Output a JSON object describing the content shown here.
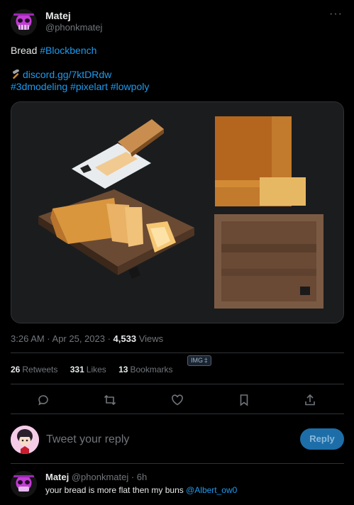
{
  "author": {
    "name": "Matej",
    "handle": "@phonkmatej",
    "avatar_icon": "purple-skull-avatar"
  },
  "tweet": {
    "line1_text": "Bread ",
    "line1_hashtag": "#Blockbench",
    "link_icon": "hammer-icon",
    "link_text": "discord.gg/7ktDRdw",
    "hashtags": "#3dmodeling #pixelart #lowpoly",
    "media_alt": "IMG"
  },
  "meta": {
    "time": "3:26 AM · Apr 25, 2023 · ",
    "views_count": "4,533",
    "views_label": " Views"
  },
  "stats": {
    "retweets_count": "26",
    "retweets_label": "Retweets",
    "likes_count": "331",
    "likes_label": "Likes",
    "bookmarks_count": "13",
    "bookmarks_label": "Bookmarks",
    "badge": "IMG ‡"
  },
  "actions": [
    "reply-icon",
    "retweet-icon",
    "like-icon",
    "bookmark-icon",
    "share-icon"
  ],
  "reply": {
    "placeholder": "Tweet your reply",
    "button_label": "Reply"
  },
  "comment": {
    "name": "Matej",
    "handle_time": " @phonkmatej · 6h",
    "text": "your bread is more flat then my buns ",
    "mention": "@Albert_ow0"
  },
  "colors": {
    "background": "#000000",
    "accent": "#1d9bf0",
    "muted": "#71767b",
    "divider": "#2f3336"
  }
}
